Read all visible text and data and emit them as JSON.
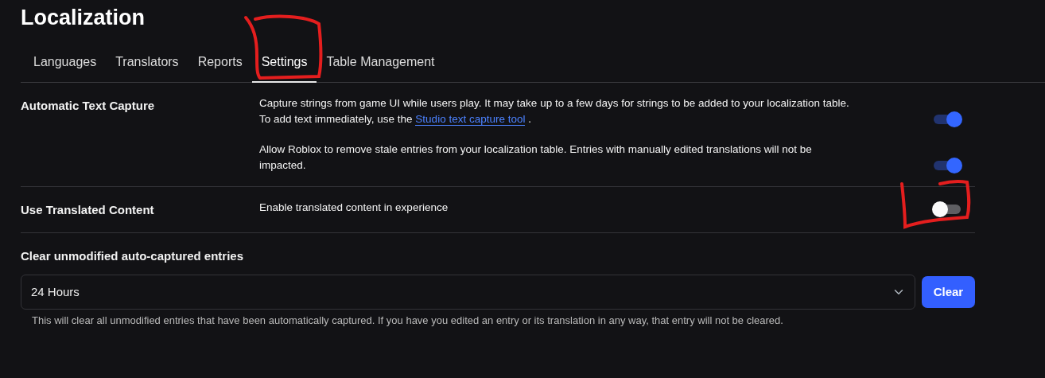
{
  "title": "Localization",
  "tabs": [
    {
      "label": "Languages",
      "selected": false,
      "circled": false
    },
    {
      "label": "Translators",
      "selected": false,
      "circled": false
    },
    {
      "label": "Reports",
      "selected": false,
      "circled": false
    },
    {
      "label": "Settings",
      "selected": true,
      "circled": true
    },
    {
      "label": "Table Management",
      "selected": false,
      "circled": false
    }
  ],
  "sections": [
    {
      "label": "Automatic Text Capture",
      "settings": [
        {
          "description": "Capture strings from game UI while users play. It may take up to a few days for strings to be added to your localization table.\nTo add text immediately, use the ",
          "link": "Studio text capture tool",
          "after": " .",
          "on": true,
          "circled": false
        },
        {
          "description": "Allow Roblox to remove stale entries from your localization table. Entries with manually edited translations will not be\nimpacted.",
          "on": true,
          "circled": false
        }
      ]
    },
    {
      "label": "Use Translated Content",
      "settings": [
        {
          "description": "Enable translated content in experience",
          "on": false,
          "circled": true
        }
      ]
    }
  ],
  "clear": {
    "label": "Clear unmodified auto-captured entries",
    "value": "24 Hours",
    "button": "Clear",
    "help": "This will clear all unmodified entries that have been automatically captured. If you have you edited an entry or its translation in any way, that entry will not be cleared."
  }
}
